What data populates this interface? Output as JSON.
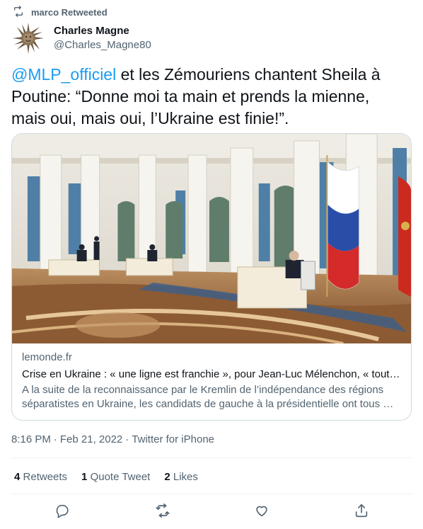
{
  "retweet_banner": {
    "text": "marco Retweeted"
  },
  "author": {
    "display_name": "Charles Magne",
    "handle": "@Charles_Magne80"
  },
  "tweet": {
    "mention": "@MLP_officiel",
    "text": " et les Zémouriens chantent Sheila à Poutine: “Donne moi ta main et prends la mienne, mais oui, mais oui, l’Ukraine est finie!”."
  },
  "card": {
    "domain": "lemonde.fr",
    "title": "Crise en Ukraine : « une ligne est franchie », pour Jean-Luc Mélenchon, « tout …",
    "description": "A la suite de la reconnaissance par le Kremlin de l’indépendance des régions séparatistes en Ukraine, les candidats de gauche à la présidentielle ont tous …"
  },
  "meta": {
    "time": "8:16 PM",
    "sep": "·",
    "date": "Feb 21, 2022",
    "source": "Twitter for iPhone"
  },
  "stats": {
    "retweets_count": "4",
    "retweets_label": "Retweets",
    "quotes_count": "1",
    "quotes_label": "Quote Tweet",
    "likes_count": "2",
    "likes_label": "Likes"
  },
  "icons": {
    "retweet_banner": "retweet-icon",
    "reply": "reply-icon",
    "retweet": "retweet-icon",
    "like": "heart-icon",
    "share": "share-icon"
  },
  "colors": {
    "link": "#1d9bf0",
    "secondary_text": "#536471",
    "border": "#cfd9de"
  }
}
